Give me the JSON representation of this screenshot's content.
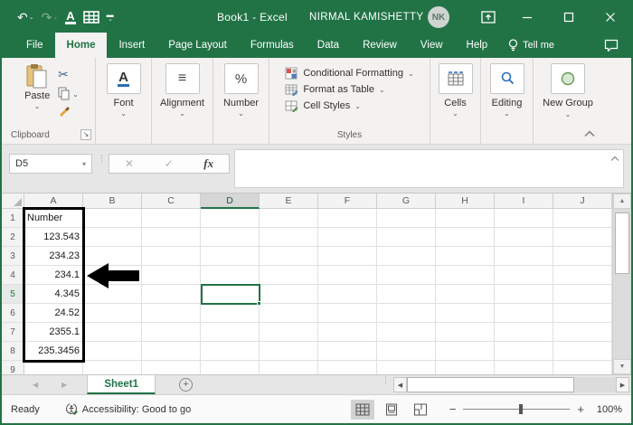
{
  "window": {
    "title": "Book1 - Excel",
    "user_name": "NIRMAL KAMISHETTY",
    "user_initials": "NK"
  },
  "icons": {
    "undo": "↶",
    "redo": "↷",
    "qat_caret": "⌄",
    "mini_caret": "⌄",
    "scissors": "✂",
    "font_letter": "A",
    "alignment_glyph": "≡",
    "percent": "%",
    "launcher_arrow": "↘",
    "collapse_chevron": "⌃",
    "namebox_caret": "▾",
    "cancel": "✕",
    "enter": "✓",
    "fx": "fx",
    "expand_chevron": "⌃",
    "up_triangle": "▲",
    "down_triangle": "▼",
    "left_triangle": "◀",
    "right_triangle": "▶",
    "plus": "+",
    "minus": "−",
    "dots": "⋮",
    "add_sheet": "+"
  },
  "tabs": {
    "items": [
      "File",
      "Home",
      "Insert",
      "Page Layout",
      "Formulas",
      "Data",
      "Review",
      "View",
      "Help"
    ],
    "active": "Home",
    "tell_me": "Tell me"
  },
  "ribbon": {
    "clipboard": {
      "paste_label": "Paste",
      "group_label": "Clipboard"
    },
    "font": {
      "group_label": "Font"
    },
    "alignment": {
      "group_label": "Alignment"
    },
    "number": {
      "group_label": "Number"
    },
    "styles": {
      "items": [
        "Conditional Formatting",
        "Format as Table",
        "Cell Styles"
      ],
      "group_label": "Styles"
    },
    "cells": {
      "group_label": "Cells"
    },
    "editing": {
      "group_label": "Editing"
    },
    "new_group": {
      "group_label": "New Group"
    }
  },
  "formula_bar": {
    "name_box": "D5",
    "value": ""
  },
  "sheet": {
    "columns": [
      "A",
      "B",
      "C",
      "D",
      "E",
      "F",
      "G",
      "H",
      "I",
      "J"
    ],
    "selected_col": "D",
    "selected_row": "5",
    "selected_cell": "D5",
    "outlined_range": "A1:A8",
    "rows": [
      {
        "n": "1",
        "a": "Number",
        "align": "left"
      },
      {
        "n": "2",
        "a": "123.543",
        "align": "right"
      },
      {
        "n": "3",
        "a": "234.23",
        "align": "right"
      },
      {
        "n": "4",
        "a": "234.1",
        "align": "right"
      },
      {
        "n": "5",
        "a": "4.345",
        "align": "right"
      },
      {
        "n": "6",
        "a": "24.52",
        "align": "right"
      },
      {
        "n": "7",
        "a": "2355.1",
        "align": "right"
      },
      {
        "n": "8",
        "a": "235.3456",
        "align": "right"
      },
      {
        "n": "9",
        "a": "",
        "align": "right"
      }
    ]
  },
  "sheet_tabs": {
    "active": "Sheet1"
  },
  "status_bar": {
    "mode": "Ready",
    "accessibility": "Accessibility: Good to go",
    "zoom": "100%"
  },
  "colors": {
    "excel_green": "#217346",
    "selection_green": "#217346",
    "range_outline": "#000000"
  }
}
